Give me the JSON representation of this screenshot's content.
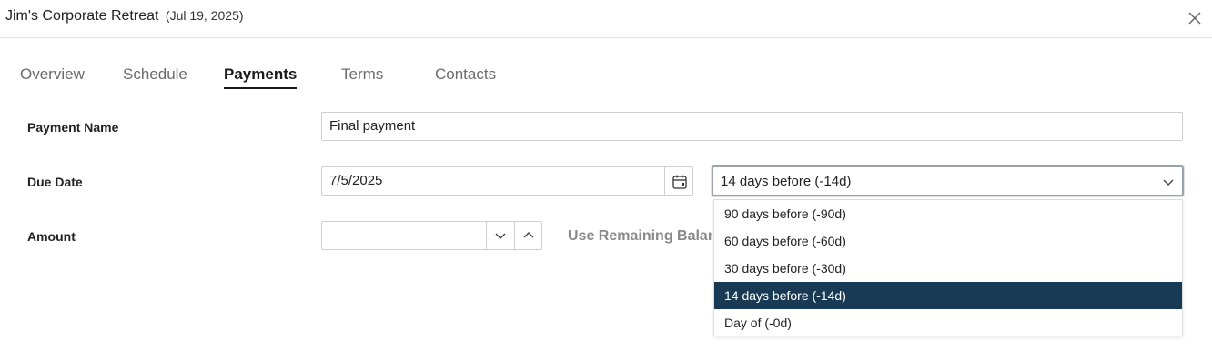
{
  "header": {
    "title": "Jim's Corporate Retreat",
    "date": "(Jul 19, 2025)",
    "close_icon": "close-icon"
  },
  "tabs": [
    {
      "label": "Overview",
      "active": false
    },
    {
      "label": "Schedule",
      "active": false
    },
    {
      "label": "Payments",
      "active": true
    },
    {
      "label": "Terms",
      "active": false
    },
    {
      "label": "Contacts",
      "active": false
    }
  ],
  "form": {
    "payment_name": {
      "label": "Payment Name",
      "value": "Final payment"
    },
    "due_date": {
      "label": "Due Date",
      "value": "7/5/2025",
      "calendar_icon": "calendar-icon",
      "offset_selected": "14 days before (-14d)",
      "offset_options": [
        "90 days before (-90d)",
        "60 days before (-60d)",
        "30 days before (-30d)",
        "14 days before (-14d)",
        "Day of (-0d)"
      ]
    },
    "amount": {
      "label": "Amount",
      "value": "",
      "use_remaining_label": "Use Remaining Balance"
    }
  },
  "colors": {
    "selected_option_bg": "#183a55",
    "tab_active": "#1a1a1a",
    "tab_inactive": "#6b6b6b"
  }
}
